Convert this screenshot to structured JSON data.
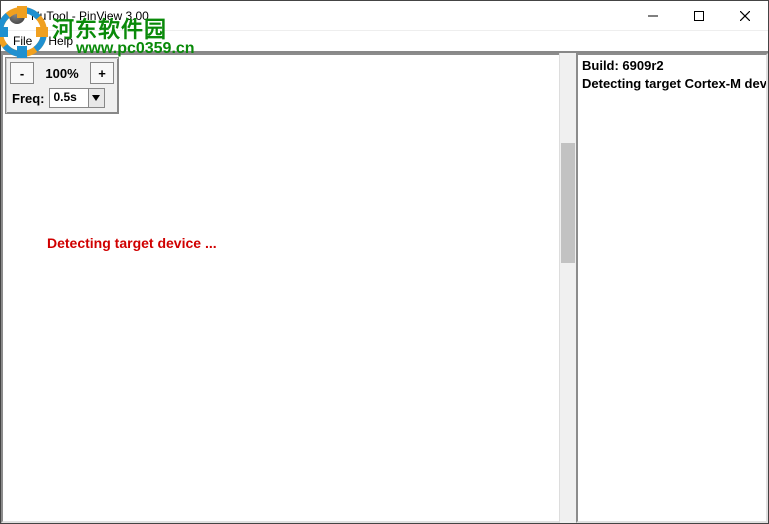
{
  "window": {
    "title": "NuTool - PinView 3.00"
  },
  "menu": {
    "file": "File",
    "help": "Help"
  },
  "toolbox": {
    "zoom_minus": "-",
    "zoom_value": "100%",
    "zoom_plus": "+",
    "freq_label": "Freq:",
    "freq_value": "0.5s"
  },
  "main": {
    "status_message": "Detecting target device ..."
  },
  "log": {
    "build_label": "Build: 6909r2",
    "line1": "Detecting target Cortex-M device"
  },
  "watermark": {
    "text1": "河东软件园",
    "text2": "www.pc0359.cn"
  }
}
